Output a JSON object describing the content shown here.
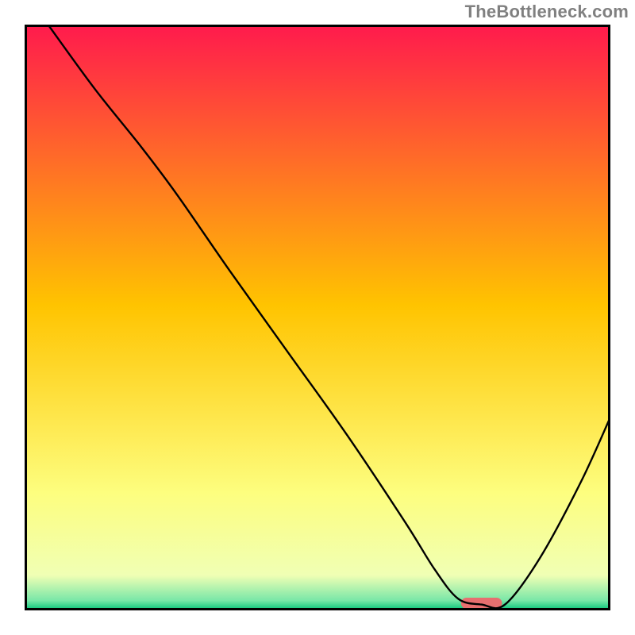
{
  "watermark": "TheBottleneck.com",
  "chart_data": {
    "type": "line",
    "title": "",
    "xlabel": "",
    "ylabel": "",
    "xlim": [
      0,
      100
    ],
    "ylim": [
      0,
      100
    ],
    "grid": false,
    "legend": false,
    "background_gradient": {
      "stops": [
        {
          "pos": 0.0,
          "color": "#ff1a4d"
        },
        {
          "pos": 0.48,
          "color": "#ffc400"
        },
        {
          "pos": 0.8,
          "color": "#fdfe7f"
        },
        {
          "pos": 0.94,
          "color": "#f0ffb4"
        },
        {
          "pos": 0.983,
          "color": "#79e7a8"
        },
        {
          "pos": 1.0,
          "color": "#00c176"
        }
      ]
    },
    "series": [
      {
        "name": "curve",
        "x": [
          4,
          12,
          20,
          26,
          35,
          45,
          55,
          65,
          70,
          74,
          78,
          82,
          88,
          95,
          100
        ],
        "y": [
          100,
          89,
          79,
          71,
          58,
          44,
          30,
          15,
          7,
          2,
          1,
          1,
          9,
          22,
          33
        ]
      }
    ],
    "marker": {
      "name": "sweet-spot",
      "x_center": 78,
      "width_pct": 7,
      "color": "#e76f6f"
    }
  }
}
